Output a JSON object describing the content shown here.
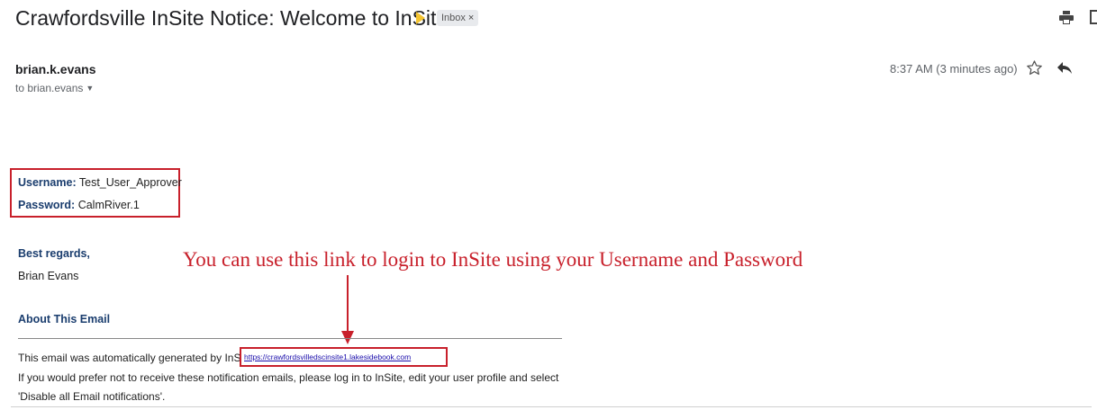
{
  "header": {
    "subject": "Crawfordsville InSite Notice: Welcome to InSite",
    "label": "Inbox",
    "label_close": "×"
  },
  "message": {
    "sender": "brian.k.evans",
    "recipient": "to brian.evans",
    "timestamp": "8:37 AM (3 minutes ago)"
  },
  "credentials": {
    "username_label": "Username:",
    "username_value": "Test_User_Approver",
    "password_label": "Password:",
    "password_value": "CalmRiver.1"
  },
  "signature": {
    "closing": "Best regards,",
    "name": "Brian Evans"
  },
  "about": {
    "heading": "About This Email",
    "auto_text": "This email was automatically generated by InSite",
    "link": "https://crawfordsvilledscinsite1.lakesidebook.com",
    "pref_line1": "If you would prefer not to receive these notification emails, please log in to InSite, edit your user profile and select",
    "pref_line2": "'Disable all Email notifications'."
  },
  "annotation": {
    "text": "You can use this link to login to InSite using your Username and Password"
  },
  "colors": {
    "annotation_red": "#c8202b",
    "heading_blue": "#1a3d6e",
    "link_blue": "#1a0dab",
    "importance_yellow": "#f4c430"
  },
  "icons": [
    "importance-marker-icon",
    "print-icon",
    "new-window-icon",
    "star-icon",
    "reply-icon",
    "chevron-down-icon",
    "arrow-down-icon"
  ]
}
